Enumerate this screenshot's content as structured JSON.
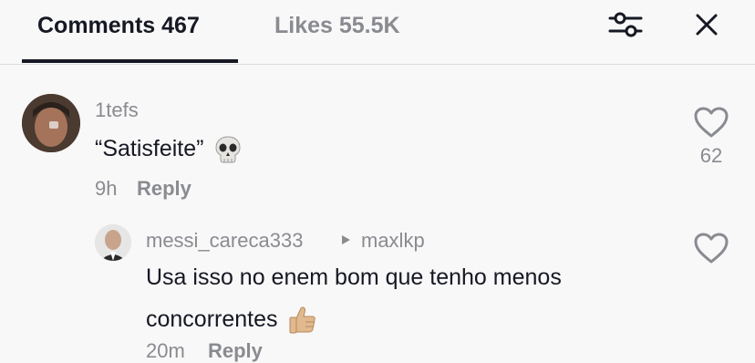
{
  "tabs": {
    "comments": "Comments 467",
    "likes": "Likes 55.5K"
  },
  "icons": {
    "filter": "filter-sliders-icon",
    "close": "close-icon",
    "like": "heart-outline-icon",
    "reply_arrow": "triangle-right-icon",
    "emoji_main": "skull-emoji",
    "emoji_reply": "thumbs-up-emoji"
  },
  "comment": {
    "username": "1tefs",
    "text": "“Satisfeite”",
    "time": "9h",
    "reply_label": "Reply",
    "likes": "62"
  },
  "reply": {
    "username": "messi_careca333",
    "reply_to": "maxlkp",
    "text": "Usa isso no enem bom que tenho menos concorrentes",
    "time": "20m",
    "reply_label": "Reply"
  },
  "colors": {
    "background": "#f8f8f8",
    "text_primary": "#161823",
    "text_secondary": "#8a8b91",
    "divider": "#dcdcdc"
  }
}
